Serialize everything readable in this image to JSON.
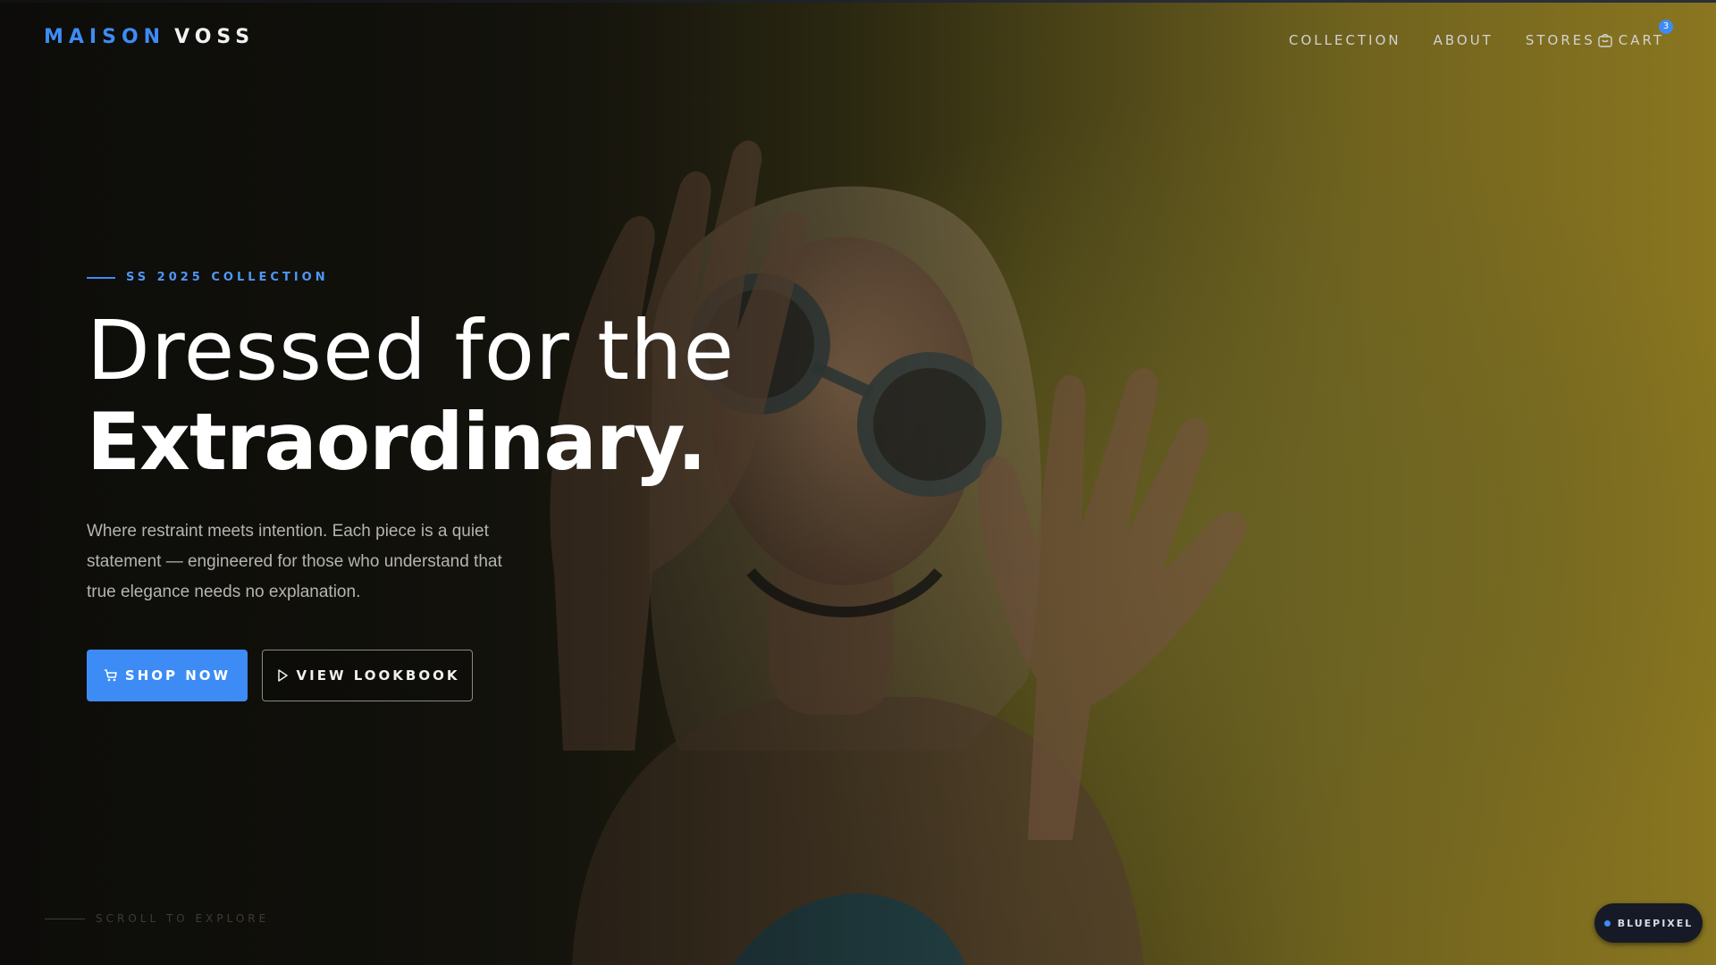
{
  "brand": {
    "part1": "MAISON",
    "part2": "VOSS"
  },
  "nav": {
    "items": [
      "COLLECTION",
      "ABOUT",
      "STORES"
    ],
    "cart_label": "CART",
    "cart_count": "3"
  },
  "hero": {
    "eyebrow": "SS 2025 COLLECTION",
    "headline_light": "Dressed for the",
    "headline_bold": "Extraordinary.",
    "description": "Where restraint meets intention. Each piece is a quiet statement — engineered for those who understand that true elegance needs no explanation.",
    "primary_button": "SHOP NOW",
    "secondary_button": "VIEW LOOKBOOK",
    "scroll_hint": "SCROLL TO EXPLORE"
  },
  "floating_badge": {
    "label": "BLUEPIXEL"
  },
  "colors": {
    "accent": "#3d8cf5",
    "background_dark": "#14130d",
    "background_warm": "#8a7620"
  },
  "icons": {
    "cart": "cart-icon",
    "shop": "cart-icon",
    "lookbook": "play-icon",
    "badge": "dot-icon"
  }
}
